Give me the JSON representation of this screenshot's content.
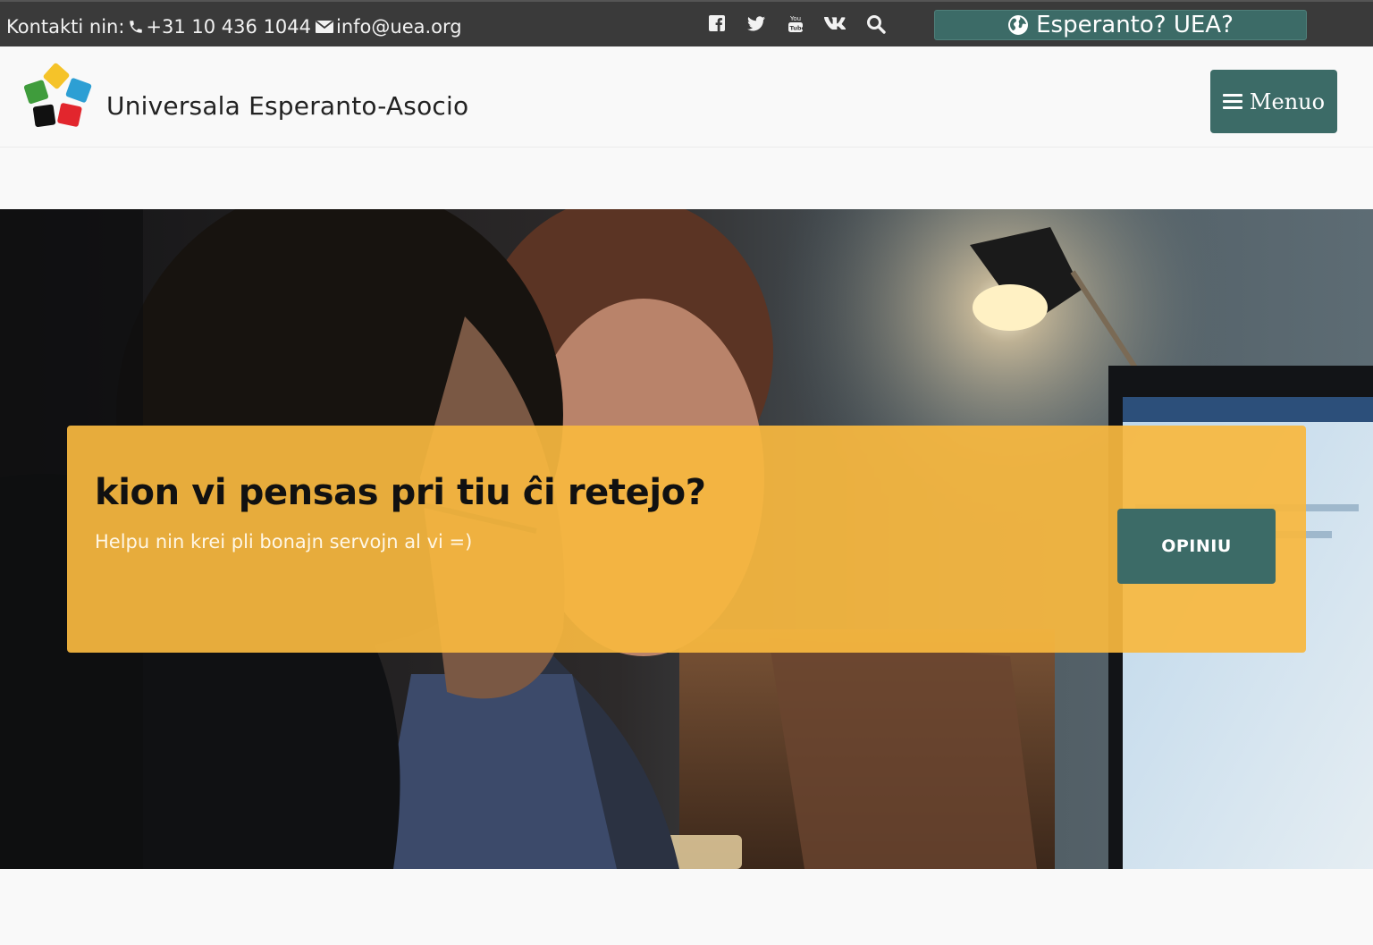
{
  "topbar": {
    "contact_label": "Kontakti nin:",
    "phone": "+31 10 436 1044",
    "email": "info@uea.org",
    "socials": [
      {
        "name": "facebook-icon"
      },
      {
        "name": "twitter-icon"
      },
      {
        "name": "youtube-icon"
      },
      {
        "name": "vk-icon"
      }
    ],
    "search_icon": "search-icon",
    "lang_button_label": "Esperanto? UEA?"
  },
  "header": {
    "site_name": "Universala Esperanto-Asocio",
    "menu_label": "Menuo"
  },
  "promo": {
    "title": "kion vi pensas pri tiu ĉi retejo?",
    "subtitle": "Helpu nin krei pli bonajn servojn al vi =)",
    "button_label": "OPINIU"
  },
  "colors": {
    "topbar_bg": "#3a3a3a",
    "accent_teal": "#3c6b67",
    "promo_yellow": "#f7b840",
    "logo_yellow": "#f5c329",
    "logo_blue": "#2d9fd4",
    "logo_green": "#3f9c3c",
    "logo_black": "#111111",
    "logo_red": "#e2262d"
  }
}
